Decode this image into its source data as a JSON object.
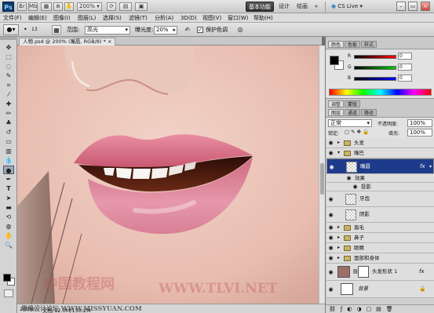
{
  "app": {
    "logo": "Ps",
    "zoom_select": "200%",
    "workspace": {
      "active": "基本功能",
      "others": [
        "设计",
        "绘画"
      ],
      "more": "»"
    },
    "cs_live": "CS Live",
    "cs_live_arrow": "▾"
  },
  "menu": [
    "文件(F)",
    "编辑(E)",
    "图像(I)",
    "图层(L)",
    "选择(S)",
    "滤镜(T)",
    "分析(A)",
    "3D(D)",
    "视图(V)",
    "窗口(W)",
    "帮助(H)"
  ],
  "options": {
    "range_label": "范围:",
    "range_value": "高光",
    "exposure_label": "曝光度:",
    "exposure_value": "20%",
    "protect_tones": "保护色调"
  },
  "document": {
    "tab_title": "人物.psd @ 200% (嘴唇, RGB/8) *",
    "zoom": "200%",
    "doc_info": "文档:12.0M/150.2M"
  },
  "panels": {
    "color_tabs": [
      "颜色",
      "色板",
      "样式"
    ],
    "sliders": [
      {
        "label": "R",
        "value": "0"
      },
      {
        "label": "G",
        "value": "0"
      },
      {
        "label": "B",
        "value": "0"
      }
    ],
    "adjust_tabs": [
      "调整",
      "蒙版"
    ],
    "layers_tabs": [
      "图层",
      "通道",
      "路径"
    ],
    "blend_mode": "正常",
    "opacity_label": "不透明度:",
    "opacity_value": "100%",
    "lock_label": "锁定:",
    "fill_label": "填充:",
    "fill_value": "100%",
    "layers": [
      {
        "name": "头发"
      },
      {
        "name": "嘴巴"
      },
      {
        "name": "嘴唇"
      },
      {
        "name": "效果"
      },
      {
        "name": "投影"
      },
      {
        "name": "牙齿"
      },
      {
        "name": "阴影"
      },
      {
        "name": "眉毛"
      },
      {
        "name": "鼻子"
      },
      {
        "name": "眼睛"
      },
      {
        "name": "面部和身体"
      },
      {
        "name": "头发形状 1"
      },
      {
        "name": "背景"
      }
    ]
  },
  "watermarks": {
    "cn": "中国教程网",
    "site1": "WWW.TLVI.NET",
    "site2": "思缘设计论坛 WWW.MISSYUAN.COM"
  },
  "colors": {
    "selection": "#1e3a8a",
    "workspace_active": "#3a3a3a",
    "fg": "#000000",
    "bg": "#ffffff"
  }
}
